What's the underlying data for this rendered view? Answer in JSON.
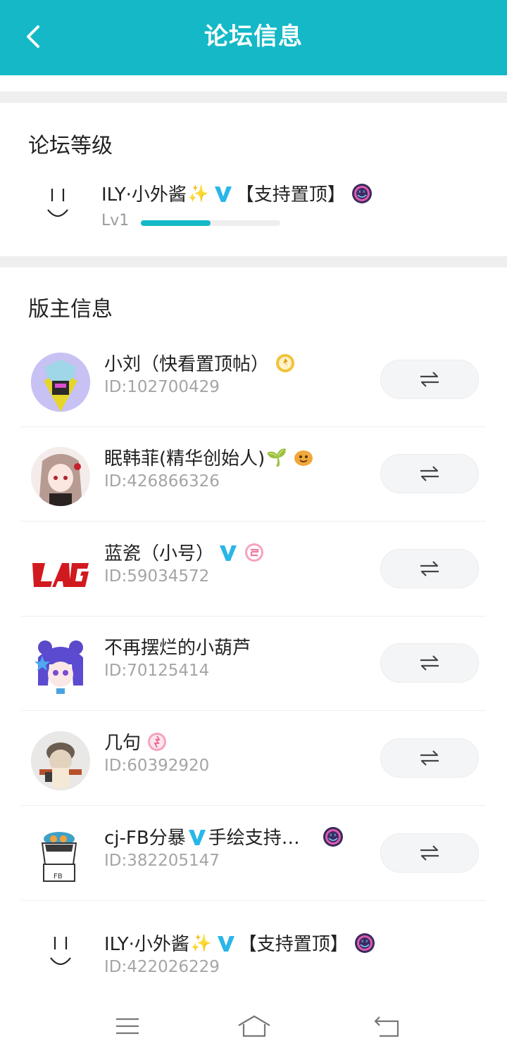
{
  "header": {
    "title": "论坛信息"
  },
  "level_section": {
    "title": "论坛等级",
    "user": {
      "name": "ILY·小外酱",
      "sparkle": "✨",
      "suffix": "【支持置顶】",
      "level_label": "Lv1",
      "progress": 0.5
    }
  },
  "mods_section": {
    "title": "版主信息",
    "mods": [
      {
        "name": "小刘（快看置顶帖）",
        "id": "ID:102700429"
      },
      {
        "name": "眠韩菲(精华创始人)",
        "sprout": "🌱",
        "id": "ID:426866326"
      },
      {
        "name": "蓝瓷（小号）",
        "id": "ID:59034572"
      },
      {
        "name": "不再摆烂的小葫芦",
        "id": "ID:70125414"
      },
      {
        "name": "几句",
        "id": "ID:60392920"
      },
      {
        "name": "cj-FB分暴",
        "suffix": "手绘支持…",
        "id": "ID:382205147"
      },
      {
        "name": "ILY·小外酱",
        "sparkle": "✨",
        "suffix": "【支持置顶】",
        "id": "ID:422026229"
      }
    ]
  },
  "colors": {
    "accent": "#14b8c6",
    "vip_blue": "#29b6e8"
  },
  "icons": [
    "back-arrow-icon",
    "swap-icon",
    "v-badge-icon",
    "smiley-badge-icon",
    "menu-icon",
    "home-icon",
    "return-icon"
  ]
}
